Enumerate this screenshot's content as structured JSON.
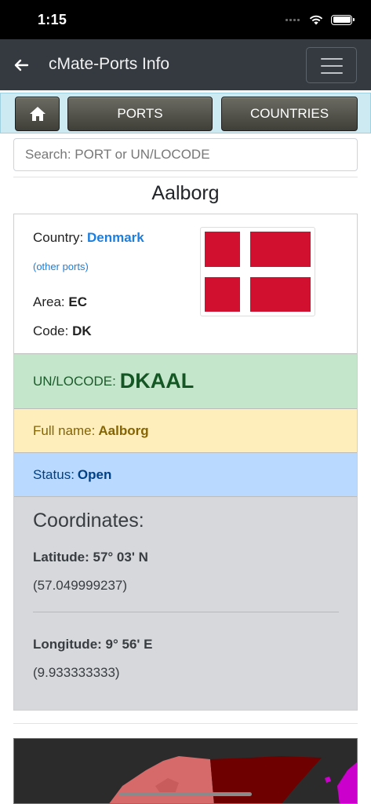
{
  "status_bar": {
    "time": "1:15"
  },
  "app_bar": {
    "title": "cMate-Ports Info"
  },
  "nav": {
    "ports_label": "PORTS",
    "countries_label": "COUNTRIES"
  },
  "search": {
    "placeholder": "Search: PORT or UN/LOCODE"
  },
  "port": {
    "name": "Aalborg",
    "country_label": "Country:",
    "country": "Denmark",
    "other_ports": "(other ports)",
    "area_label": "Area:",
    "area": "EC",
    "code_label": "Code:",
    "code": "DK",
    "locode_label": "UN/LOCODE:",
    "locode": "DKAAL",
    "fullname_label": "Full name:",
    "fullname": "Aalborg",
    "status_label": "Status:",
    "status": "Open"
  },
  "coordinates": {
    "title": "Coordinates:",
    "latitude": "Latitude: 57° 03' N",
    "latitude_decimal": "(57.049999237)",
    "longitude": "Longitude: 9° 56' E",
    "longitude_decimal": "(9.933333333)"
  },
  "colors": {
    "app_bar": "#343a40",
    "nav_strip": "#cde9f1",
    "link": "#1a7fe0",
    "locode_band": "#c4e6cb",
    "fullname_band": "#feeebb",
    "status_band": "#b9dafe",
    "coords_band": "#d6d8dc",
    "flag_red": "#d0102e"
  },
  "icons": {
    "back": "arrow-left-icon",
    "menu": "hamburger-icon",
    "home": "home-icon",
    "flag": "denmark-flag"
  }
}
